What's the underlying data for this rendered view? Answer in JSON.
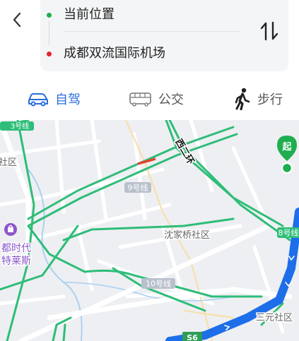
{
  "header": {
    "origin_label": "当前位置",
    "destination_label": "成都双流国际机场"
  },
  "modes": [
    {
      "label": "自驾",
      "icon": "car-icon",
      "selected": true
    },
    {
      "label": "公交",
      "icon": "bus-icon",
      "selected": false
    },
    {
      "label": "步行",
      "icon": "walk-icon",
      "selected": false
    }
  ],
  "map": {
    "labels": {
      "ring_road": "西二环",
      "district_a": "沈家桥社区",
      "district_b": "三元社区",
      "district_edge": "社区",
      "poi": "都时代\n特莱斯",
      "metro_9": "9号线",
      "metro_10": "10号线",
      "metro_8": "8号线",
      "metro_3": "3号线",
      "highway": "S6",
      "start_marker": "起"
    }
  },
  "colors": {
    "accent": "#2a6fdb",
    "origin_dot": "#1fae4f",
    "dest_dot": "#e8232c",
    "route_blue": "#1d6ee8",
    "major_road": "#2ebd78"
  }
}
